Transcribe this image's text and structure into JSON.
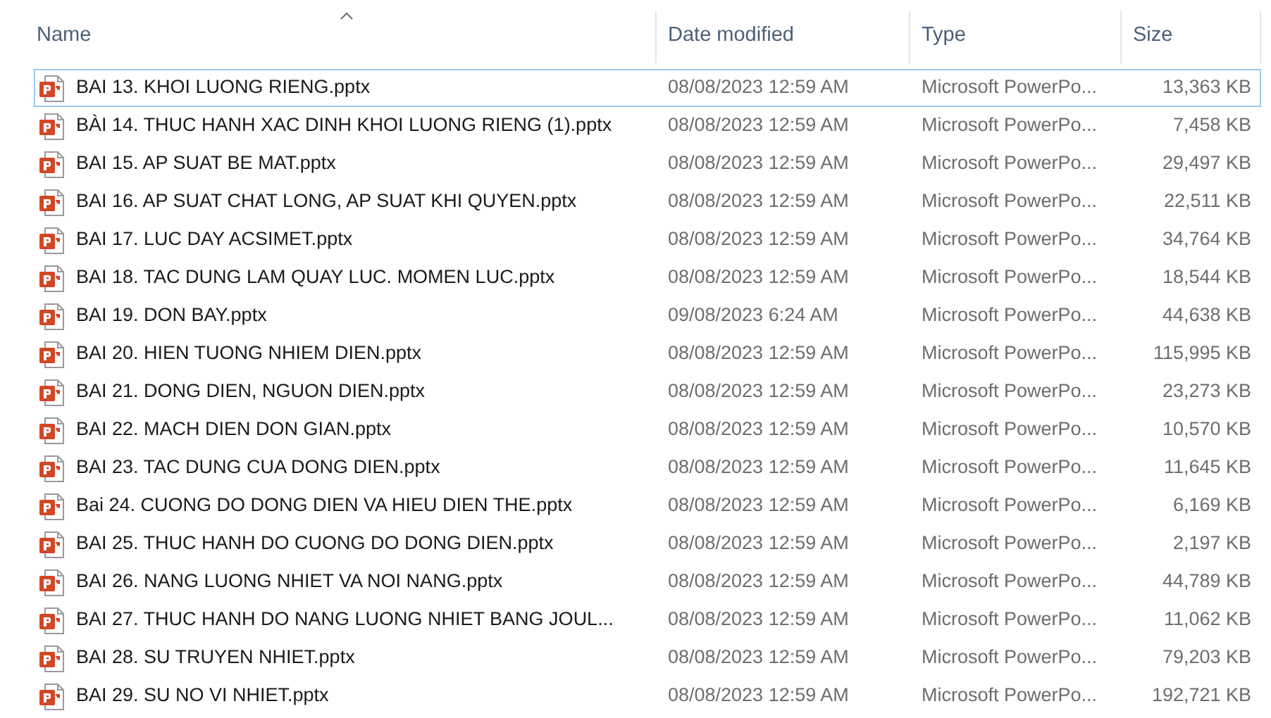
{
  "columns": [
    {
      "label": "Name",
      "sorted": true
    },
    {
      "label": "Date modified",
      "sorted": false
    },
    {
      "label": "Type",
      "sorted": false
    },
    {
      "label": "Size",
      "sorted": false
    }
  ],
  "rows": [
    {
      "name": "BAI 13. KHOI LUONG RIENG.pptx",
      "date": "08/08/2023 12:59 AM",
      "type": "Microsoft PowerPo...",
      "size": "13,363 KB",
      "focused": true
    },
    {
      "name": "BÀI 14. THUC HANH XAC DINH KHOI LUONG RIENG (1).pptx",
      "date": "08/08/2023 12:59 AM",
      "type": "Microsoft PowerPo...",
      "size": "7,458 KB",
      "focused": false
    },
    {
      "name": "BAI 15. AP SUAT BE MAT.pptx",
      "date": "08/08/2023 12:59 AM",
      "type": "Microsoft PowerPo...",
      "size": "29,497 KB",
      "focused": false
    },
    {
      "name": "BAI 16. AP SUAT CHAT LONG, AP SUAT KHI QUYEN.pptx",
      "date": "08/08/2023 12:59 AM",
      "type": "Microsoft PowerPo...",
      "size": "22,511 KB",
      "focused": false
    },
    {
      "name": "BAI 17. LUC DAY ACSIMET.pptx",
      "date": "08/08/2023 12:59 AM",
      "type": "Microsoft PowerPo...",
      "size": "34,764 KB",
      "focused": false
    },
    {
      "name": "BAI 18. TAC DUNG LAM QUAY LUC. MOMEN LUC.pptx",
      "date": "08/08/2023 12:59 AM",
      "type": "Microsoft PowerPo...",
      "size": "18,544 KB",
      "focused": false
    },
    {
      "name": "BAI 19. DON BAY.pptx",
      "date": "09/08/2023 6:24 AM",
      "type": "Microsoft PowerPo...",
      "size": "44,638 KB",
      "focused": false
    },
    {
      "name": "BAI 20. HIEN TUONG NHIEM DIEN.pptx",
      "date": "08/08/2023 12:59 AM",
      "type": "Microsoft PowerPo...",
      "size": "115,995 KB",
      "focused": false
    },
    {
      "name": "BAI 21. DONG DIEN, NGUON DIEN.pptx",
      "date": "08/08/2023 12:59 AM",
      "type": "Microsoft PowerPo...",
      "size": "23,273 KB",
      "focused": false
    },
    {
      "name": "BAI 22. MACH DIEN DON GIAN.pptx",
      "date": "08/08/2023 12:59 AM",
      "type": "Microsoft PowerPo...",
      "size": "10,570 KB",
      "focused": false
    },
    {
      "name": "BAI 23. TAC DUNG CUA DONG DIEN.pptx",
      "date": "08/08/2023 12:59 AM",
      "type": "Microsoft PowerPo...",
      "size": "11,645 KB",
      "focused": false
    },
    {
      "name": "Bai 24. CUONG DO DONG DIEN VA HIEU DIEN THE.pptx",
      "date": "08/08/2023 12:59 AM",
      "type": "Microsoft PowerPo...",
      "size": "6,169 KB",
      "focused": false
    },
    {
      "name": "BAI 25. THUC HANH DO CUONG DO DONG DIEN.pptx",
      "date": "08/08/2023 12:59 AM",
      "type": "Microsoft PowerPo...",
      "size": "2,197 KB",
      "focused": false
    },
    {
      "name": "BAI 26. NANG LUONG NHIET VA NOI NANG.pptx",
      "date": "08/08/2023 12:59 AM",
      "type": "Microsoft PowerPo...",
      "size": "44,789 KB",
      "focused": false
    },
    {
      "name": "BAI 27. THUC HANH DO NANG LUONG NHIET BANG JOUL...",
      "date": "08/08/2023 12:59 AM",
      "type": "Microsoft PowerPo...",
      "size": "11,062 KB",
      "focused": false
    },
    {
      "name": "BAI 28. SU TRUYEN NHIET.pptx",
      "date": "08/08/2023 12:59 AM",
      "type": "Microsoft PowerPo...",
      "size": "79,203 KB",
      "focused": false
    },
    {
      "name": "BAI 29. SU NO VI NHIET.pptx",
      "date": "08/08/2023 12:59 AM",
      "type": "Microsoft PowerPo...",
      "size": "192,721 KB",
      "focused": false
    }
  ]
}
